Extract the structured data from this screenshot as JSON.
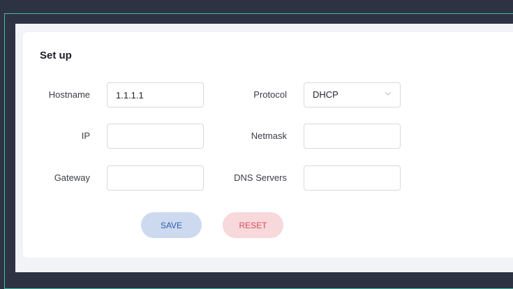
{
  "form": {
    "title": "Set up",
    "hostname": {
      "label": "Hostname",
      "value": "1.1.1.1"
    },
    "protocol": {
      "label": "Protocol",
      "value": "DHCP"
    },
    "ip": {
      "label": "IP",
      "value": ""
    },
    "netmask": {
      "label": "Netmask",
      "value": ""
    },
    "gateway": {
      "label": "Gateway",
      "value": ""
    },
    "dns_servers": {
      "label": "DNS Servers",
      "value": ""
    }
  },
  "actions": {
    "save_label": "SAVE",
    "reset_label": "RESET"
  },
  "colors": {
    "background": "#2d3343",
    "frame_border": "#46b9a3",
    "card": "#ffffff",
    "save_bg": "#cdd9ef",
    "save_text": "#2f5bb1",
    "reset_bg": "#f7d8db",
    "reset_text": "#d74c58"
  },
  "icons": {
    "protocol_dropdown": "chevron-down-icon"
  }
}
